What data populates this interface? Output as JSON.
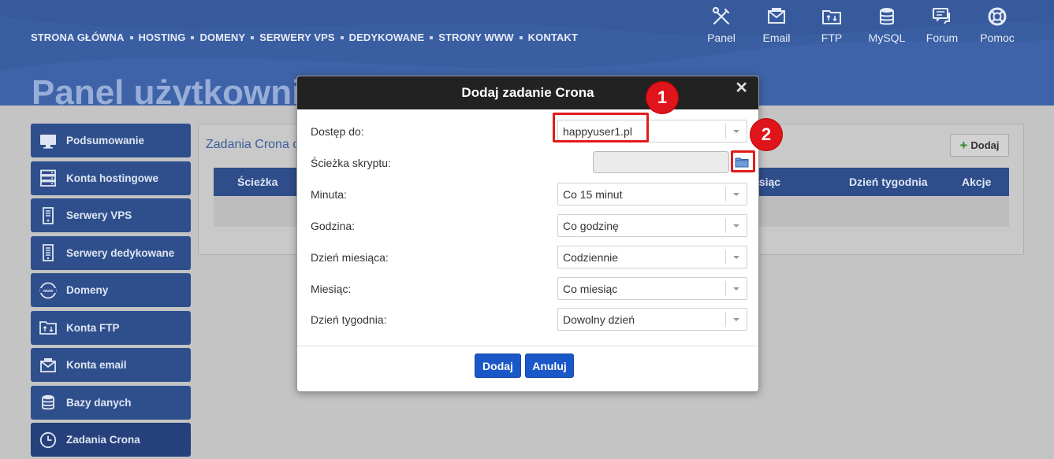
{
  "topnav": [
    "STRONA GŁÓWNA",
    "HOSTING",
    "DOMENY",
    "SERWERY VPS",
    "DEDYKOWANE",
    "STRONY WWW",
    "KONTAKT"
  ],
  "quicklinks": [
    {
      "label": "Panel",
      "icon": "tools-icon"
    },
    {
      "label": "Email",
      "icon": "email-icon"
    },
    {
      "label": "FTP",
      "icon": "ftp-folder-icon"
    },
    {
      "label": "MySQL",
      "icon": "database-icon"
    },
    {
      "label": "Forum",
      "icon": "forum-icon"
    },
    {
      "label": "Pomoc",
      "icon": "lifebuoy-icon"
    }
  ],
  "page_title": "Panel użytkowni",
  "sidebar": [
    {
      "label": "Podsumowanie",
      "icon": "monitor-icon"
    },
    {
      "label": "Konta hostingowe",
      "icon": "server-icon"
    },
    {
      "label": "Serwery VPS",
      "icon": "vps-icon"
    },
    {
      "label": "Serwery dedykowane",
      "icon": "dedicated-server-icon"
    },
    {
      "label": "Domeny",
      "icon": "globe-www-icon"
    },
    {
      "label": "Konta FTP",
      "icon": "ftp-folder-icon"
    },
    {
      "label": "Konta email",
      "icon": "email-icon"
    },
    {
      "label": "Bazy danych",
      "icon": "database-icon"
    },
    {
      "label": "Zadania Crona",
      "icon": "clock-icon",
      "active": true
    }
  ],
  "main": {
    "title": "Zadania Crona c",
    "add_label": "Dodaj",
    "columns": [
      "Ścieżka",
      "esiąc",
      "Dzień tygodnia",
      "Akcje"
    ]
  },
  "modal": {
    "title": "Dodaj zadanie Crona",
    "close": "✕",
    "fields": [
      {
        "label": "Dostęp do:",
        "value": "happyuser1.pl",
        "type": "select"
      },
      {
        "label": "Ścieżka skryptu:",
        "value": "",
        "type": "path"
      },
      {
        "label": "Minuta:",
        "value": "Co 15 minut",
        "type": "select"
      },
      {
        "label": "Godzina:",
        "value": "Co godzinę",
        "type": "select"
      },
      {
        "label": "Dzień miesiąca:",
        "value": "Codziennie",
        "type": "select"
      },
      {
        "label": "Miesiąc:",
        "value": "Co miesiąc",
        "type": "select"
      },
      {
        "label": "Dzień tygodnia:",
        "value": "Dowolny dzień",
        "type": "select"
      }
    ],
    "submit_label": "Dodaj",
    "cancel_label": "Anuluj"
  },
  "annotations": [
    "1",
    "2"
  ],
  "colors": {
    "header": "#3a5ea2",
    "sidebar": "#2f4f8c",
    "primary_button": "#1a57c7",
    "highlight": "#e21b1b"
  }
}
